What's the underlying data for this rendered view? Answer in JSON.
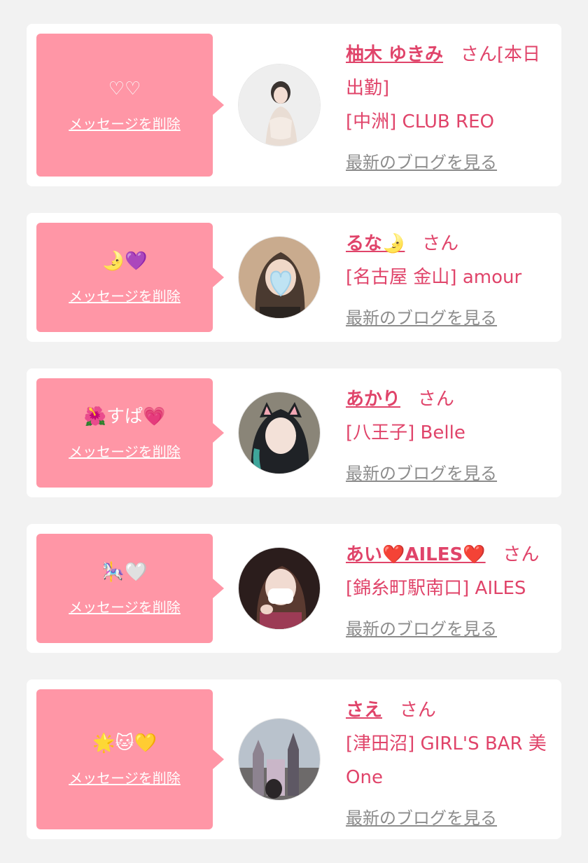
{
  "delete_label": "メッセージを削除",
  "blog_label": "最新のブログを見る",
  "honorific": "さん",
  "colors": {
    "accent": "#e0446a",
    "bubble": "#ff96a6",
    "muted": "#8c8c8c",
    "background": "#f2f2f2"
  },
  "entries": [
    {
      "message": "♡♡",
      "name": "柚木 ゆきみ",
      "status": "[本日出勤]",
      "shop": "[中洲] CLUB REO",
      "avatar": "avatar-photo-woman-light"
    },
    {
      "message": "🌛💜",
      "name": "るな🌛",
      "status": "",
      "shop": "[名古屋 金山] amour",
      "avatar": "avatar-photo-blue-heart"
    },
    {
      "message": "🌺すぱ💗",
      "name": "あかり",
      "status": "",
      "shop": "[八王子] Belle",
      "avatar": "avatar-photo-cat-ears"
    },
    {
      "message": "🎠🤍",
      "name": "あい❤️AILES❤️",
      "status": "",
      "shop": "[錦糸町駅南口] AILES",
      "avatar": "avatar-photo-mask"
    },
    {
      "message": "🌟🐱💛",
      "name": "さえ",
      "status": "",
      "shop": "[津田沼] GIRL'S BAR 美One",
      "avatar": "avatar-photo-castle"
    }
  ]
}
